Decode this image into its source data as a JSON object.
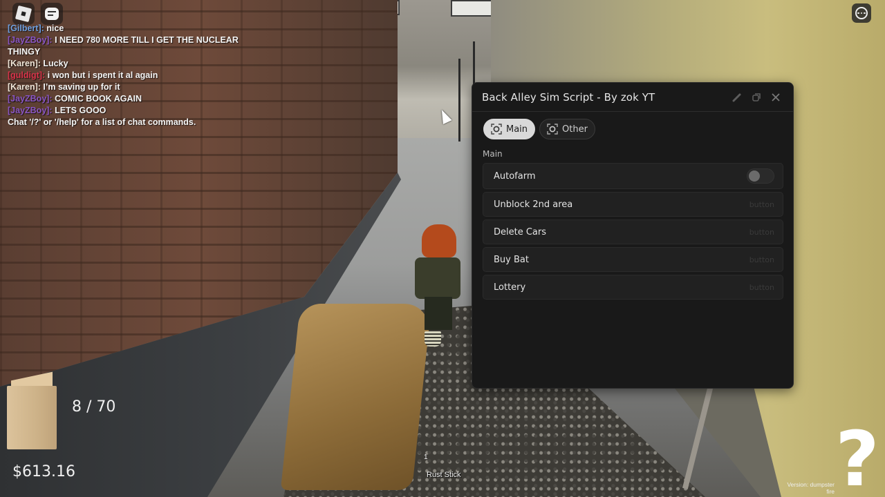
{
  "game": {
    "title": "Back Alley Sim"
  },
  "topbar": {
    "roblox_button_icon": "roblox-logo-icon",
    "chat_button_icon": "chat-icon",
    "more_button_icon": "more-options-icon"
  },
  "chat": {
    "messages": [
      {
        "name": "[Gilbert]:",
        "name_color": "#6fa0e0",
        "text": "nice"
      },
      {
        "name": "[JayZBoy]:",
        "name_color": "#8a56c4",
        "text": "I NEED 780 MORE TILL I GET THE NUCLEAR THINGY"
      },
      {
        "name": "[Karen]:",
        "name_color": "#f0e6d8",
        "text": "Lucky"
      },
      {
        "name": "[guldigt]:",
        "name_color": "#d9334a",
        "text": "i won but i spent it al again"
      },
      {
        "name": "[Karen]:",
        "name_color": "#f0e6d8",
        "text": "I’m saving up for it"
      },
      {
        "name": "[JayZBoy]:",
        "name_color": "#8a56c4",
        "text": "COMIC BOOK AGAIN"
      },
      {
        "name": "[JayZBoy]:",
        "name_color": "#8a56c4",
        "text": "LETS GOOO"
      }
    ],
    "system_message": "Chat '/?' or '/help' for a list of chat commands."
  },
  "script_window": {
    "title": "Back Alley Sim Script - By zok YT",
    "controls": {
      "edit_icon": "brush-icon",
      "minimize_icon": "restore-icon",
      "close_icon": "close-icon"
    },
    "tabs": [
      {
        "label": "Main",
        "icon": "target-icon",
        "active": true
      },
      {
        "label": "Other",
        "icon": "target-icon",
        "active": false
      }
    ],
    "section_title": "Main",
    "rows": [
      {
        "label": "Autofarm",
        "type": "toggle",
        "state": "off"
      },
      {
        "label": "Unblock 2nd area",
        "type": "button",
        "hint": "button"
      },
      {
        "label": "Delete Cars",
        "type": "button",
        "hint": "button"
      },
      {
        "label": "Buy Bat",
        "type": "button",
        "hint": "button"
      },
      {
        "label": "Lottery",
        "type": "button",
        "hint": "button"
      }
    ]
  },
  "hud": {
    "bag_count": "8 / 70",
    "money": "$613.16",
    "hotbar": {
      "slot_number": "1",
      "item_label": "Rust Stick"
    },
    "help_symbol": "?",
    "version": "Version: dumpster fire"
  },
  "colors": {
    "window_bg": "#191919",
    "row_bg": "#212121",
    "active_tab_bg": "#d9d9d9",
    "text_primary": "#e4e4e4"
  }
}
